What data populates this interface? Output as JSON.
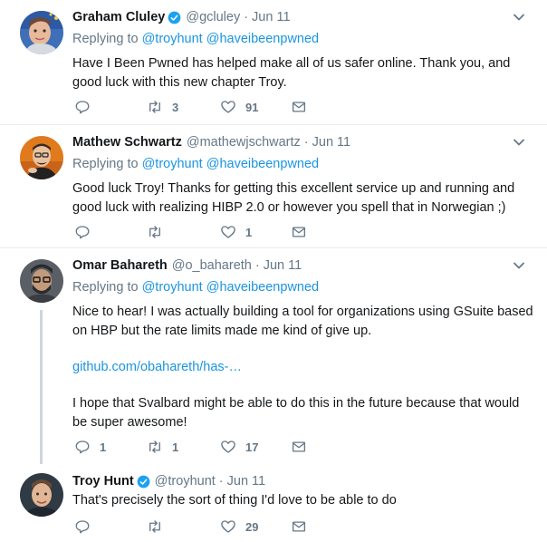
{
  "tweets": [
    {
      "name": "Graham Cluley",
      "verified": true,
      "handle": "@gcluley",
      "time": "Jun 11",
      "replying_label": "Replying to",
      "mentions": [
        "@troyhunt",
        "@haveibeenpwned"
      ],
      "paragraphs": [
        "Have I Been Pwned has helped make all of us safer online. Thank you, and good luck with this new chapter Troy."
      ],
      "replies": "",
      "retweets": "3",
      "likes": "91"
    },
    {
      "name": "Mathew Schwartz",
      "verified": false,
      "handle": "@mathewjschwartz",
      "time": "Jun 11",
      "replying_label": "Replying to",
      "mentions": [
        "@troyhunt",
        "@haveibeenpwned"
      ],
      "paragraphs": [
        "Good luck Troy! Thanks for getting this excellent service up and running and good luck with realizing HIBP 2.0 or however you spell that in Norwegian ;)"
      ],
      "replies": "",
      "retweets": "",
      "likes": "1"
    },
    {
      "name": "Omar Bahareth",
      "verified": false,
      "handle": "@o_bahareth",
      "time": "Jun 11",
      "replying_label": "Replying to",
      "mentions": [
        "@troyhunt",
        "@haveibeenpwned"
      ],
      "paragraphs": [
        "Nice to hear! I was actually building a tool for organizations using GSuite based on HBP but the rate limits made me kind of give up.",
        "github.com/obahareth/has-…",
        "I hope that Svalbard might be able to do this in the future because that would be super awesome!"
      ],
      "replies": "1",
      "retweets": "1",
      "likes": "17"
    },
    {
      "name": "Troy Hunt",
      "verified": true,
      "handle": "@troyhunt",
      "time": "Jun 11",
      "paragraphs": [
        "That's precisely the sort of thing I'd love to be able to do"
      ],
      "replies": "",
      "retweets": "",
      "likes": "29"
    }
  ],
  "dot": "·",
  "colors": {
    "accent": "#1b95e0",
    "muted": "#657786",
    "divider": "#e6ecf0",
    "thread": "#ccd6dd"
  },
  "icons": [
    "verified-icon",
    "chevron-down-icon",
    "reply-icon",
    "retweet-icon",
    "like-icon",
    "direct-message-icon"
  ]
}
